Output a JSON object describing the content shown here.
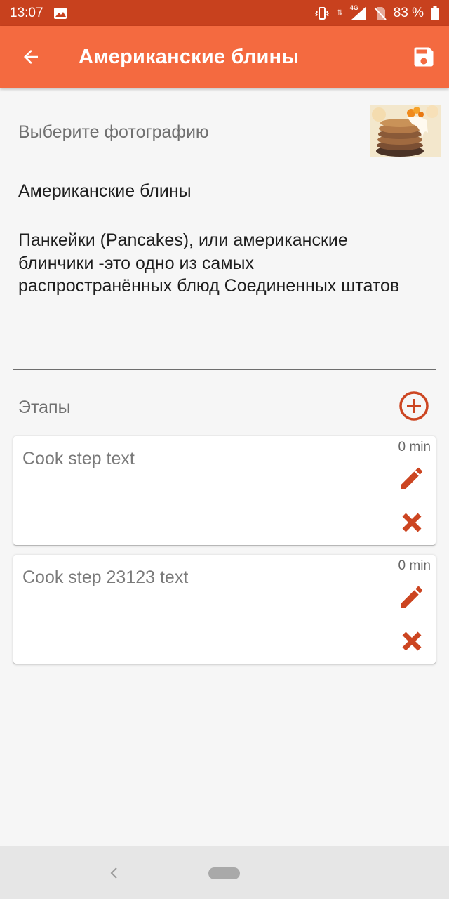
{
  "status_bar": {
    "time": "13:07",
    "network": "4G",
    "battery": "83 %"
  },
  "app_bar": {
    "title": "Американские блины",
    "back_icon": "arrow-back-icon",
    "save_icon": "save-icon"
  },
  "recipe": {
    "photo_label": "Выберите фотографию",
    "name_value": "Американские блины",
    "description": "Панкейки (Pancakes), или американские блинчики -это одно из самых распространённых блюд Соединенных штатов"
  },
  "steps": {
    "header": "Этапы",
    "items": [
      {
        "text": "Cook step text",
        "time": "0 min"
      },
      {
        "text": "Cook step 23123 text",
        "time": "0 min"
      }
    ]
  },
  "colors": {
    "status_bar": "#c8411e",
    "app_bar": "#f46a40",
    "accent": "#cc4521"
  }
}
